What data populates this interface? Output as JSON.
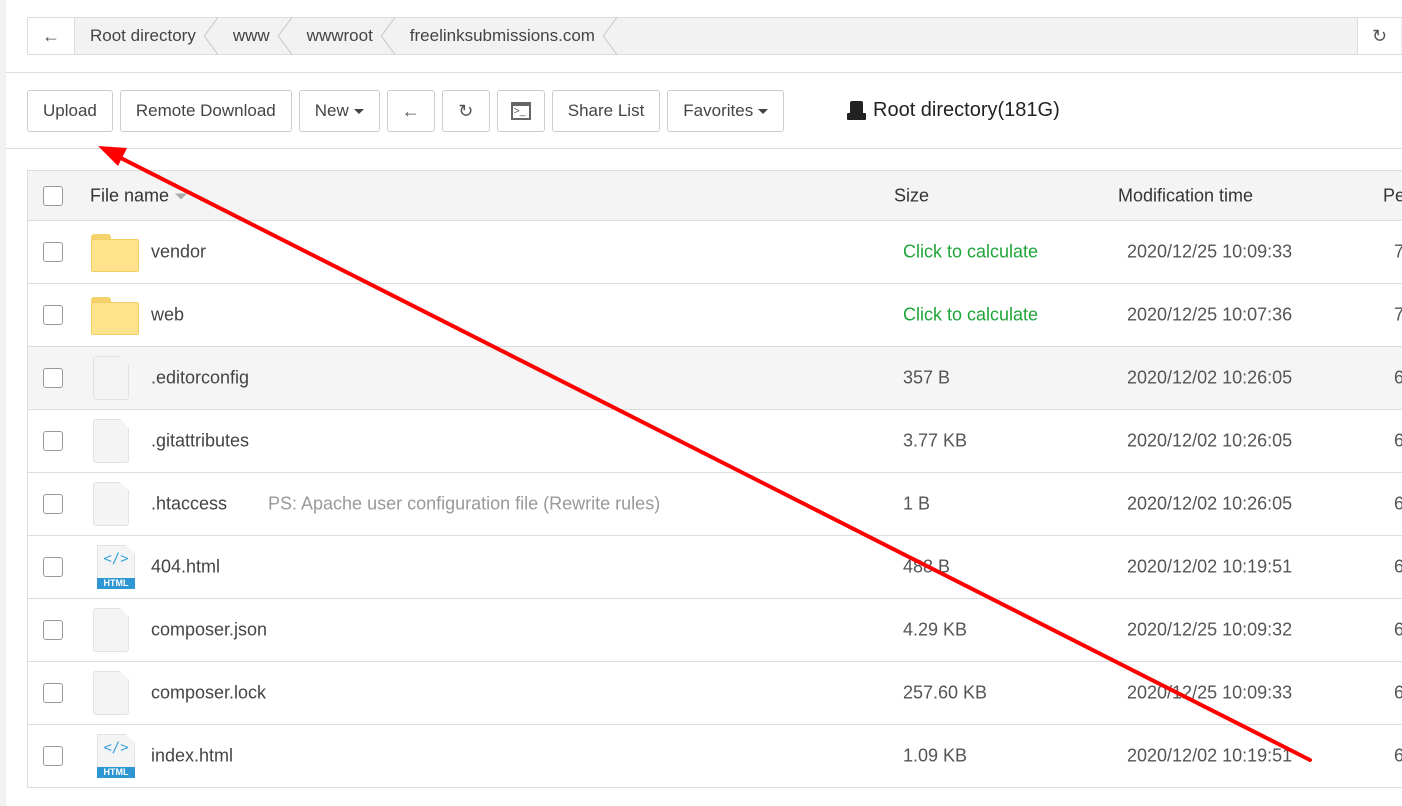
{
  "breadcrumb": {
    "items": [
      "Root directory",
      "www",
      "wwwroot",
      "freelinksubmissions.com"
    ]
  },
  "toolbar": {
    "upload": "Upload",
    "remote_download": "Remote Download",
    "new": "New",
    "share_list": "Share List",
    "favorites": "Favorites"
  },
  "disk": {
    "label": "Root directory(181G)"
  },
  "table": {
    "headers": {
      "name": "File name",
      "size": "Size",
      "time": "Modification time",
      "perm": "Pe"
    },
    "rows": [
      {
        "type": "folder",
        "name": "vendor",
        "size": "Click to calculate",
        "time": "2020/12/25 10:09:33",
        "perm": "7"
      },
      {
        "type": "folder",
        "name": "web",
        "size": "Click to calculate",
        "time": "2020/12/25 10:07:36",
        "perm": "7"
      },
      {
        "type": "file",
        "name": ".editorconfig",
        "size": "357 B",
        "time": "2020/12/02 10:26:05",
        "perm": "6"
      },
      {
        "type": "file",
        "name": ".gitattributes",
        "size": "3.77 KB",
        "time": "2020/12/02 10:26:05",
        "perm": "6"
      },
      {
        "type": "file",
        "name": ".htaccess",
        "note": "PS: Apache user configuration file (Rewrite rules)",
        "size": "1 B",
        "time": "2020/12/02 10:26:05",
        "perm": "6"
      },
      {
        "type": "html",
        "name": "404.html",
        "size": "488 B",
        "time": "2020/12/02 10:19:51",
        "perm": "6"
      },
      {
        "type": "file",
        "name": "composer.json",
        "size": "4.29 KB",
        "time": "2020/12/25 10:09:32",
        "perm": "6"
      },
      {
        "type": "file",
        "name": "composer.lock",
        "size": "257.60 KB",
        "time": "2020/12/25 10:09:33",
        "perm": "6"
      },
      {
        "type": "html",
        "name": "index.html",
        "size": "1.09 KB",
        "time": "2020/12/02 10:19:51",
        "perm": "6"
      }
    ]
  },
  "icons": {
    "html_code": "</>",
    "html_tag": "HTML"
  },
  "colors": {
    "accent_green": "#20a53a",
    "annotation_red": "#ff0000"
  }
}
